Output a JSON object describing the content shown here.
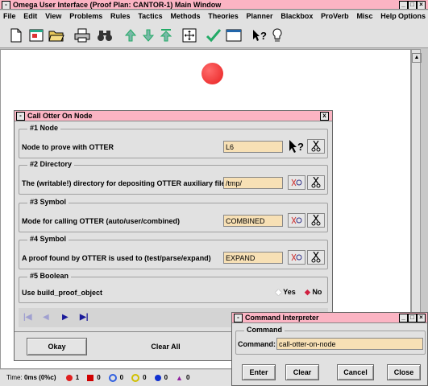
{
  "main_window": {
    "title": "Omega User Interface (Proof Plan: CANTOR-1) Main Window",
    "menu": [
      "File",
      "Edit",
      "View",
      "Problems",
      "Rules",
      "Tactics",
      "Methods",
      "Theories",
      "Planner",
      "Blackbox",
      "ProVerb",
      "Misc",
      "Help"
    ],
    "options_label": "Options",
    "toolbar_icons": [
      "new-document-icon",
      "window-icon",
      "open-folder-icon",
      "print-icon",
      "binoculars-icon",
      "arrow-up-icon",
      "arrow-down-icon",
      "arrow-top-icon",
      "move-icon",
      "check-icon",
      "panel-icon",
      "help-icon",
      "lightbulb-icon"
    ]
  },
  "status_bar": {
    "time_label": "Time:",
    "time_value": "0ms (0%c)",
    "counters": [
      {
        "shape": "circle",
        "color": "#e02020",
        "count": "1"
      },
      {
        "shape": "square",
        "color": "#d00000",
        "count": "0"
      },
      {
        "shape": "circle-outline",
        "color": "#3060e0",
        "count": "0"
      },
      {
        "shape": "circle-outline",
        "color": "#d0c000",
        "count": "0"
      },
      {
        "shape": "circle",
        "color": "#1030d0",
        "count": "0"
      },
      {
        "shape": "triangle",
        "color": "#9020a0",
        "count": "0"
      }
    ]
  },
  "node": {
    "color": "#e82020"
  },
  "call_otter": {
    "title": "Call Otter On Node",
    "close_label": "x",
    "sections": [
      {
        "group": "#1 Node",
        "label": "Node to prove with OTTER",
        "value": "L6"
      },
      {
        "group": "#2 Directory",
        "label": "The (writable!) directory for depositing OTTER auxiliary files",
        "value": "/tmp/"
      },
      {
        "group": "#3 Symbol",
        "label": "Mode for calling OTTER (auto/user/combined)",
        "value": "COMBINED"
      },
      {
        "group": "#4 Symbol",
        "label": "A proof found by OTTER is used to (test/parse/expand)",
        "value": "EXPAND"
      }
    ],
    "boolean": {
      "group": "#5 Boolean",
      "label": "Use build_proof_object",
      "yes": "Yes",
      "no": "No",
      "selected": "No"
    },
    "okay_label": "Okay",
    "clear_label": "Clear All"
  },
  "command_interpreter": {
    "title": "Command Interpreter",
    "group": "Command",
    "command_label": "Command:",
    "command_value": "call-otter-on-node",
    "buttons": [
      "Enter",
      "Clear",
      "Cancel",
      "Close"
    ]
  }
}
